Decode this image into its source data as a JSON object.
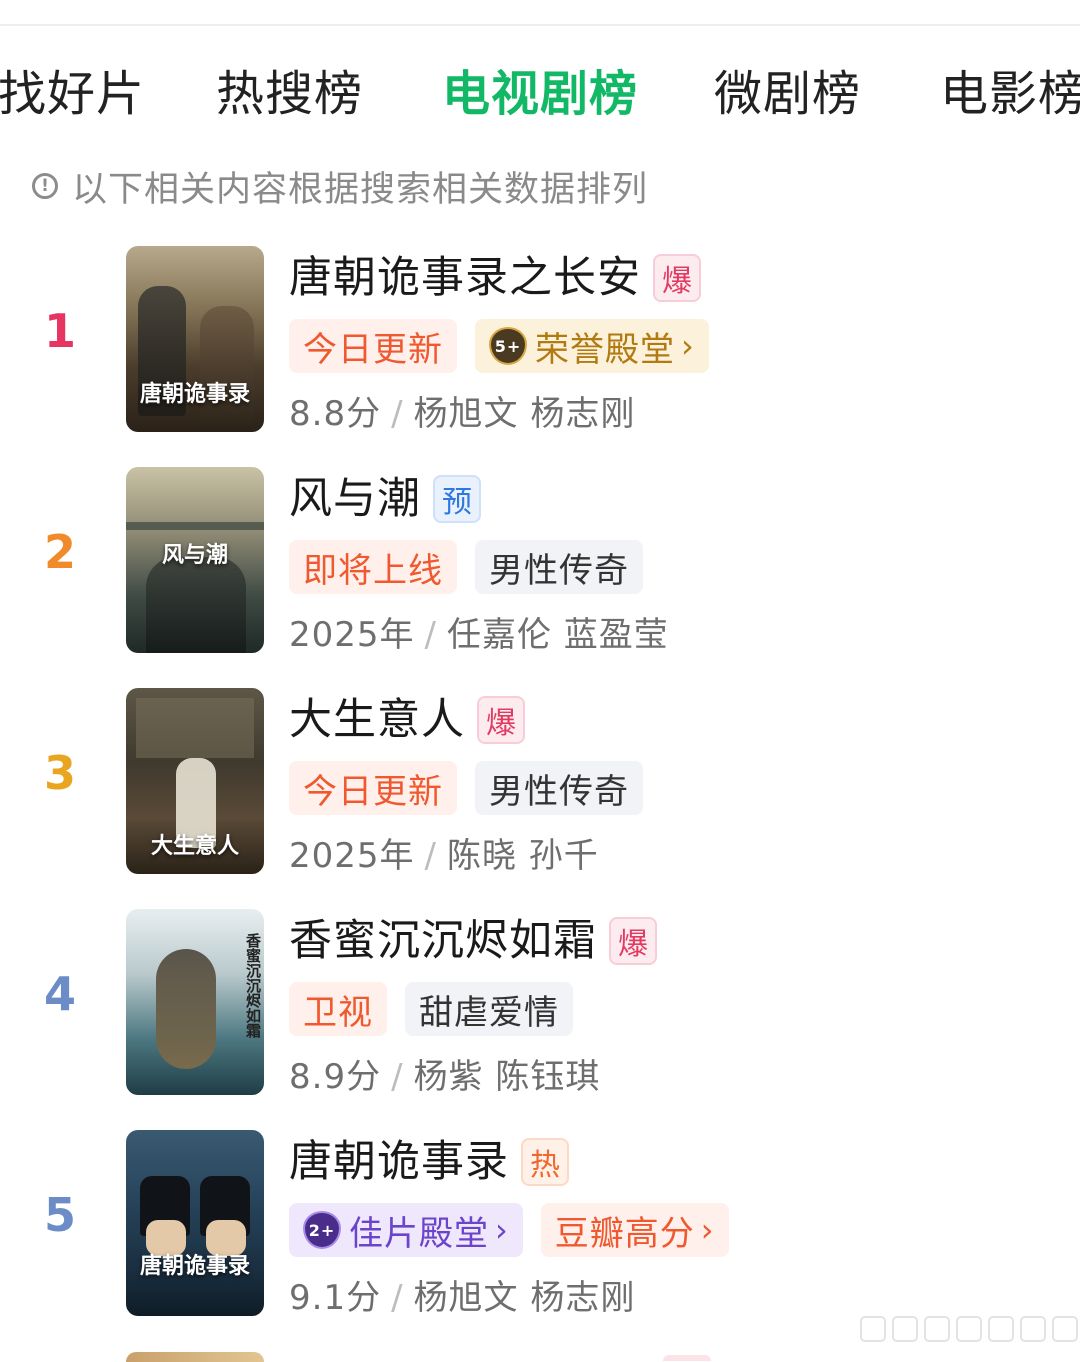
{
  "tabs": [
    {
      "label": "找好片",
      "active": false
    },
    {
      "label": "热搜榜",
      "active": false
    },
    {
      "label": "电视剧榜",
      "active": true
    },
    {
      "label": "微剧榜",
      "active": false
    },
    {
      "label": "电影榜",
      "active": false
    }
  ],
  "notice": {
    "icon": "info-icon",
    "text": "以下相关内容根据搜索相关数据排列"
  },
  "items": [
    {
      "rank": "1",
      "rank_color": "#e63561",
      "title": "唐朝诡事录之长安",
      "flag": "爆",
      "tags": [
        {
          "text": "今日更新"
        },
        {
          "text": "荣誉殿堂",
          "badge": "5+"
        }
      ],
      "meta_a": "8.8分",
      "meta_sep": "/",
      "meta_b": "杨旭文 杨志刚",
      "poster_title": "唐朝诡事录"
    },
    {
      "rank": "2",
      "rank_color": "#f08a2a",
      "title": "风与潮",
      "flag": "预",
      "tags": [
        {
          "text": "即将上线"
        },
        {
          "text": "男性传奇"
        }
      ],
      "meta_a": "2025年",
      "meta_sep": "/",
      "meta_b": "任嘉伦 蓝盈莹",
      "poster_title": "风与潮"
    },
    {
      "rank": "3",
      "rank_color": "#e9a520",
      "title": "大生意人",
      "flag": "爆",
      "tags": [
        {
          "text": "今日更新"
        },
        {
          "text": "男性传奇"
        }
      ],
      "meta_a": "2025年",
      "meta_sep": "/",
      "meta_b": "陈晓 孙千",
      "poster_title": "大生意人"
    },
    {
      "rank": "4",
      "rank_color": "#6b8cc7",
      "title": "香蜜沉沉烬如霜",
      "flag": "爆",
      "tags": [
        {
          "text": "卫视"
        },
        {
          "text": "甜虐爱情"
        }
      ],
      "meta_a": "8.9分",
      "meta_sep": "/",
      "meta_b": "杨紫 陈钰琪",
      "poster_title": "香蜜沉沉烬如霜"
    },
    {
      "rank": "5",
      "rank_color": "#6b8cc7",
      "title": "唐朝诡事录",
      "flag": "热",
      "tags": [
        {
          "text": "佳片殿堂",
          "badge": "2+"
        },
        {
          "text": "豆瓣高分"
        }
      ],
      "meta_a": "9.1分",
      "meta_sep": "/",
      "meta_b": "杨旭文 杨志刚",
      "poster_title": "唐朝诡事录"
    }
  ]
}
